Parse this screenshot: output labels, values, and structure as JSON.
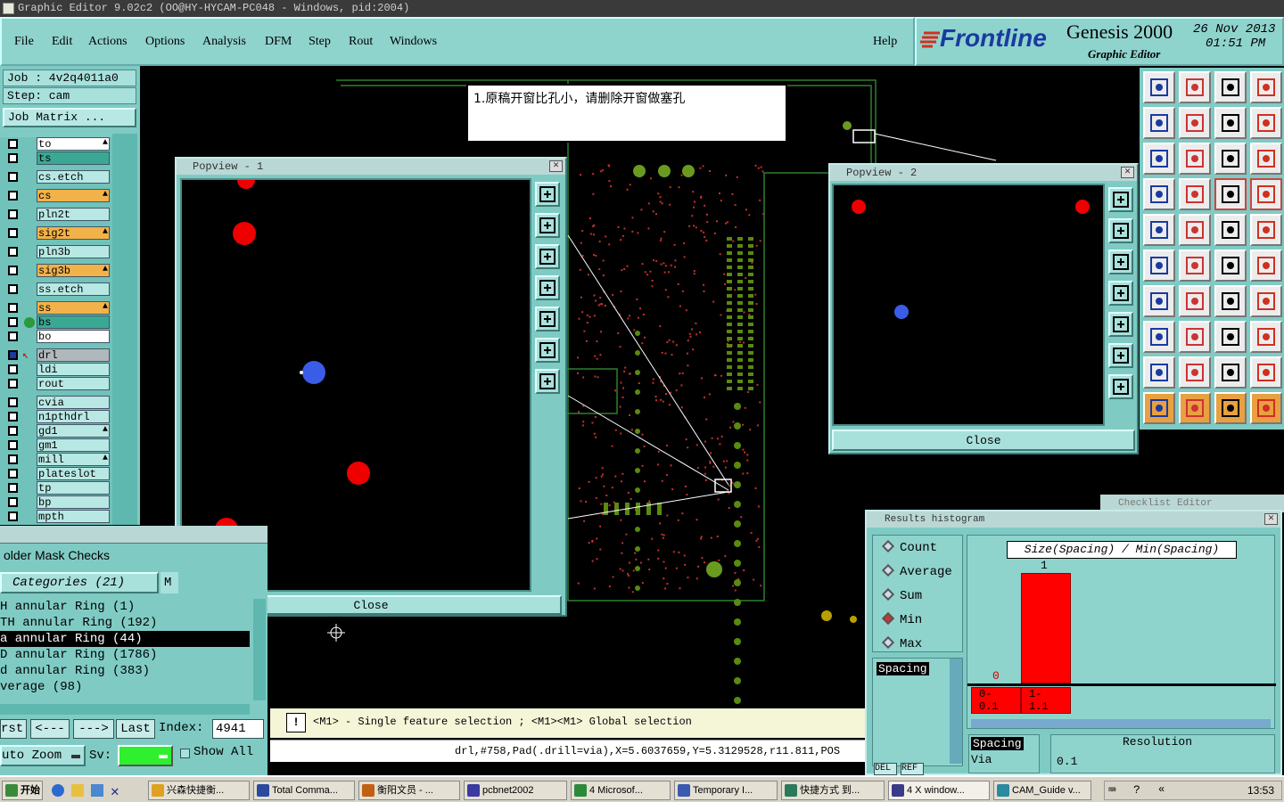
{
  "window": {
    "title": "Graphic Editor 9.02c2 (OO@HY-HYCAM-PC048 - Windows, pid:2004)"
  },
  "menu": {
    "items": [
      "File",
      "Edit",
      "Actions",
      "Options",
      "Analysis",
      "DFM",
      "Step",
      "Rout",
      "Windows"
    ],
    "help": "Help"
  },
  "brand": {
    "logo": "Frontline",
    "product": "Genesis 2000",
    "subtitle": "Graphic Editor",
    "date": "26 Nov 2013",
    "time": "01:51 PM"
  },
  "job": {
    "job": "Job : 4v2q4011a0",
    "step": "Step: cam",
    "matrix_button": "Job Matrix ..."
  },
  "layers": [
    {
      "name": "to",
      "style": "w",
      "tag": true
    },
    {
      "name": "ts",
      "style": "g",
      "tag": false
    },
    {
      "name": "cs.etch",
      "style": "",
      "tag": false
    },
    {
      "name": "cs",
      "style": "y",
      "tag": true
    },
    {
      "name": "pln2t",
      "style": "",
      "tag": false
    },
    {
      "name": "sig2t",
      "style": "y",
      "tag": true
    },
    {
      "name": "pln3b",
      "style": "",
      "tag": false
    },
    {
      "name": "sig3b",
      "style": "y",
      "tag": true
    },
    {
      "name": "ss.etch",
      "style": "",
      "tag": false
    },
    {
      "name": "ss",
      "style": "y",
      "tag": true
    },
    {
      "name": "bs",
      "style": "g",
      "tag": false
    },
    {
      "name": "bo",
      "style": "w",
      "tag": false
    },
    {
      "name": "drl",
      "style": "gr",
      "tag": false
    },
    {
      "name": "ldi",
      "style": "",
      "tag": false
    },
    {
      "name": "rout",
      "style": "",
      "tag": false
    },
    {
      "name": "cvia",
      "style": "",
      "tag": false
    },
    {
      "name": "n1pthdrl",
      "style": "",
      "tag": false
    },
    {
      "name": "gd1",
      "style": "",
      "tag": true
    },
    {
      "name": "gm1",
      "style": "",
      "tag": false
    },
    {
      "name": "mill",
      "style": "",
      "tag": true
    },
    {
      "name": "plateslot",
      "style": "",
      "tag": false
    },
    {
      "name": "tp",
      "style": "",
      "tag": false
    },
    {
      "name": "bp",
      "style": "",
      "tag": false
    },
    {
      "name": "mpth",
      "style": "",
      "tag": false
    }
  ],
  "note": {
    "text": "1.原稿开窗比孔小，请删除开窗做塞孔"
  },
  "popview1": {
    "title": "Popview - 1",
    "close": "Close"
  },
  "popview2": {
    "title": "Popview - 2",
    "close": "Close"
  },
  "soldermask": {
    "title": "older Mask Checks",
    "categories_label": "Categories (21)",
    "col_m": "M",
    "rows": [
      "H annular Ring (1)",
      "TH annular Ring (192)",
      "a annular Ring (44)",
      "D annular Ring (1786)",
      "d annular Ring (383)",
      "verage (98)"
    ],
    "selected_index": 2,
    "nav": {
      "first": "rst",
      "prev": "<---",
      "next": "--->",
      "last": "Last",
      "index_label": "Index:",
      "index_value": "4941"
    },
    "zoom_label": "uto Zoom",
    "sv_label": "Sv:",
    "show_all": "Show All"
  },
  "status": {
    "message": "<M1> - Single feature selection ; <M1><M1> Global selection",
    "selection": "drl,#758,Pad(.drill=via),X=5.6037659,Y=5.3129528,r11.811,POS"
  },
  "checklist": {
    "title": "Checklist Editor"
  },
  "results": {
    "title": "Results histogram",
    "modes": [
      "Count",
      "Average",
      "Sum",
      "Min",
      "Max"
    ],
    "selected_mode": "Min",
    "chart_title": "Size(Spacing) / Min(Spacing)",
    "bar_top_label": "1",
    "bar_bottom_label": "0",
    "bin1": "0- 0.1",
    "bin2": "1- 1.1",
    "list_item": "Spacing",
    "buttons": [
      "DEL",
      "REF"
    ],
    "field_label1": "Spacing",
    "field_label2": "Via",
    "resolution_label": "Resolution",
    "resolution_value": "0.1"
  },
  "taskbar": {
    "start": "开始",
    "tasks": [
      "兴森快捷衡...",
      "Total Comma...",
      "衡阳文员 - ...",
      "pcbnet2002",
      "4 Microsof...",
      "Temporary I...",
      "快捷方式 到...",
      "4 X window...",
      "CAM_Guide v..."
    ],
    "clock": "13:53"
  }
}
